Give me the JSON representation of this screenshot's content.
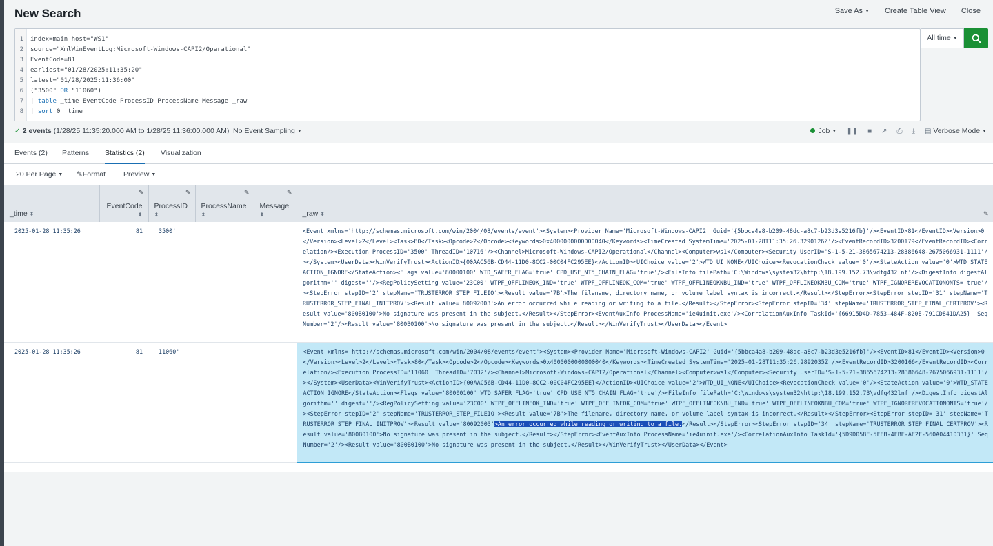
{
  "header": {
    "title": "New Search",
    "save_as": "Save As",
    "create_table_view": "Create Table View",
    "close": "Close"
  },
  "search": {
    "line_numbers": [
      "1",
      "2",
      "3",
      "4",
      "5",
      "6",
      "7",
      "8"
    ],
    "lines": [
      "index=main host=\"WS1\"",
      "source=\"XmlWinEventLog:Microsoft-Windows-CAPI2/Operational\"",
      "EventCode=81",
      "earliest=\"01/28/2025:11:35:20\"",
      "latest=\"01/28/2025:11:36:00\"",
      "(\"3500\" OR \"11060\")",
      "| table _time EventCode ProcessID ProcessName Message _raw",
      "| sort 0 _time"
    ],
    "time_range": "All time"
  },
  "status": {
    "events_count": "2 events",
    "events_range": "(1/28/25 11:35:20.000 AM to 1/28/25 11:36:00.000 AM)",
    "sampling": "No Event Sampling",
    "job": "Job",
    "mode": "Verbose Mode"
  },
  "tabs": [
    {
      "label": "Events (2)"
    },
    {
      "label": "Patterns"
    },
    {
      "label": "Statistics (2)"
    },
    {
      "label": "Visualization"
    }
  ],
  "tools": {
    "per_page": "20 Per Page",
    "format": "Format",
    "preview": "Preview"
  },
  "table": {
    "columns": [
      "_time",
      "EventCode",
      "ProcessID",
      "ProcessName",
      "Message",
      "_raw"
    ],
    "rows": [
      {
        "time": "2025-01-28 11:35:26",
        "eventcode": "81",
        "processid": "'3500'",
        "processname": "",
        "message": "",
        "raw": "<Event xmlns='http://schemas.microsoft.com/win/2004/08/events/event'><System><Provider Name='Microsoft-Windows-CAPI2' Guid='{5bbca4a8-b209-48dc-a8c7-b23d3e5216fb}'/><EventID>81</EventID><Version>0</Version><Level>2</Level><Task>80</Task><Opcode>2</Opcode><Keywords>0x4000000000000040</Keywords><TimeCreated SystemTime='2025-01-28T11:35:26.3290126Z'/><EventRecordID>3200179</EventRecordID><Correlation/><Execution ProcessID='3500' ThreadID='10716'/><Channel>Microsoft-Windows-CAPI2/Operational</Channel><Computer>ws1</Computer><Security UserID='S-1-5-21-3865674213-28386648-2675066931-1111'/></System><UserData><WinVerifyTrust><ActionID>{00AAC56B-CD44-11D0-8CC2-00C04FC295EE}</ActionID><UIChoice value='2'>WTD_UI_NONE</UIChoice><RevocationCheck value='0'/><StateAction value='0'>WTD_STATEACTION_IGNORE</StateAction><Flags value='80000100' WTD_SAFER_FLAG='true' CPD_USE_NT5_CHAIN_FLAG='true'/><FileInfo filePath='C:\\Windows\\system32\\http:\\18.199.152.73\\vdfg432lnf'/><DigestInfo digestAlgorithm='' digest=''/><RegPolicySetting value='23C00' WTPF_OFFLINEOK_IND='true' WTPF_OFFLINEOK_COM='true' WTPF_OFFLINEOKNBU_IND='true' WTPF_OFFLINEOKNBU_COM='true' WTPF_IGNOREREVOCATIONONTS='true'/><StepError stepID='2' stepName='TRUSTERROR_STEP_FILEIO'><Result value='7B'>The filename, directory name, or volume label syntax is incorrect.</Result></StepError><StepError stepID='31' stepName='TRUSTERROR_STEP_FINAL_INITPROV'><Result value='80092003'>An error occurred while reading or writing to a file.</Result></StepError><StepError stepID='34' stepName='TRUSTERROR_STEP_FINAL_CERTPROV'><Result value='800B0100'>No signature was present in the subject.</Result></StepError><EventAuxInfo ProcessName='ie4uinit.exe'/><CorrelationAuxInfo TaskId='{66915D4D-7853-484F-820E-791CD841DA25}' SeqNumber='2'/><Result value='800B0100'>No signature was present in the subject.</Result></WinVerifyTrust></UserData></Event>"
      },
      {
        "time": "2025-01-28 11:35:26",
        "eventcode": "81",
        "processid": "'11060'",
        "processname": "",
        "message": "",
        "raw_before": "<Event xmlns='http://schemas.microsoft.com/win/2004/08/events/event'><System><Provider Name='Microsoft-Windows-CAPI2' Guid='{5bbca4a8-b209-48dc-a8c7-b23d3e5216fb}'/><EventID>81</EventID><Version>0</Version><Level>2</Level><Task>80</Task><Opcode>2</Opcode><Keywords>0x4000000000000040</Keywords><TimeCreated SystemTime='2025-01-28T11:35:26.2892035Z'/><EventRecordID>3200166</EventRecordID><Correlation/><Execution ProcessID='11060' ThreadID='7032'/><Channel>Microsoft-Windows-CAPI2/Operational</Channel><Computer>ws1</Computer><Security UserID='S-1-5-21-3865674213-28386648-2675066931-1111'/></System><UserData><WinVerifyTrust><ActionID>{00AAC56B-CD44-11D0-8CC2-00C04FC295EE}</ActionID><UIChoice value='2'>WTD_UI_NONE</UIChoice><RevocationCheck value='0'/><StateAction value='0'>WTD_STATEACTION_IGNORE</StateAction><Flags value='80000100' WTD_SAFER_FLAG='true' CPD_USE_NT5_CHAIN_FLAG='true'/><FileInfo filePath='C:\\Windows\\system32\\http:\\18.199.152.73\\vdfg432lnf'/><DigestInfo digestAlgorithm='' digest=''/><RegPolicySetting value='23C00' WTPF_OFFLINEOK_IND='true' WTPF_OFFLINEOK_COM='true' WTPF_OFFLINEOKNBU_IND='true' WTPF_OFFLINEOKNBU_COM='true' WTPF_IGNOREREVOCATIONONTS='true'/><StepError stepID='2' stepName='TRUSTERROR_STEP_FILEIO'><Result value='7B'>The filename, directory name, or volume label syntax is incorrect.</Result></StepError><StepError stepID='31' stepName='TRUSTERROR_STEP_FINAL_INITPROV'><Result value='80092003'",
        "raw_highlight": ">An error occurred while reading or writing to a file.",
        "raw_after": "</Result></StepError><StepError stepID='34' stepName='TRUSTERROR_STEP_FINAL_CERTPROV'><Result value='800B0100'>No signature was present in the subject.</Result></StepError><EventAuxInfo ProcessName='ie4uinit.exe'/><CorrelationAuxInfo TaskId='{5D9D058E-5FEB-4FBE-AE2F-560A04410331}' SeqNumber='2'/><Result value='800B0100'>No signature was present in the subject.</Result></WinVerifyTrust></UserData></Event>"
      }
    ]
  },
  "colors": {
    "accent": "#1a6fb3",
    "go_button": "#1a9035",
    "selection_bg": "#c2e8f7",
    "highlight": "#1a4fb8"
  }
}
